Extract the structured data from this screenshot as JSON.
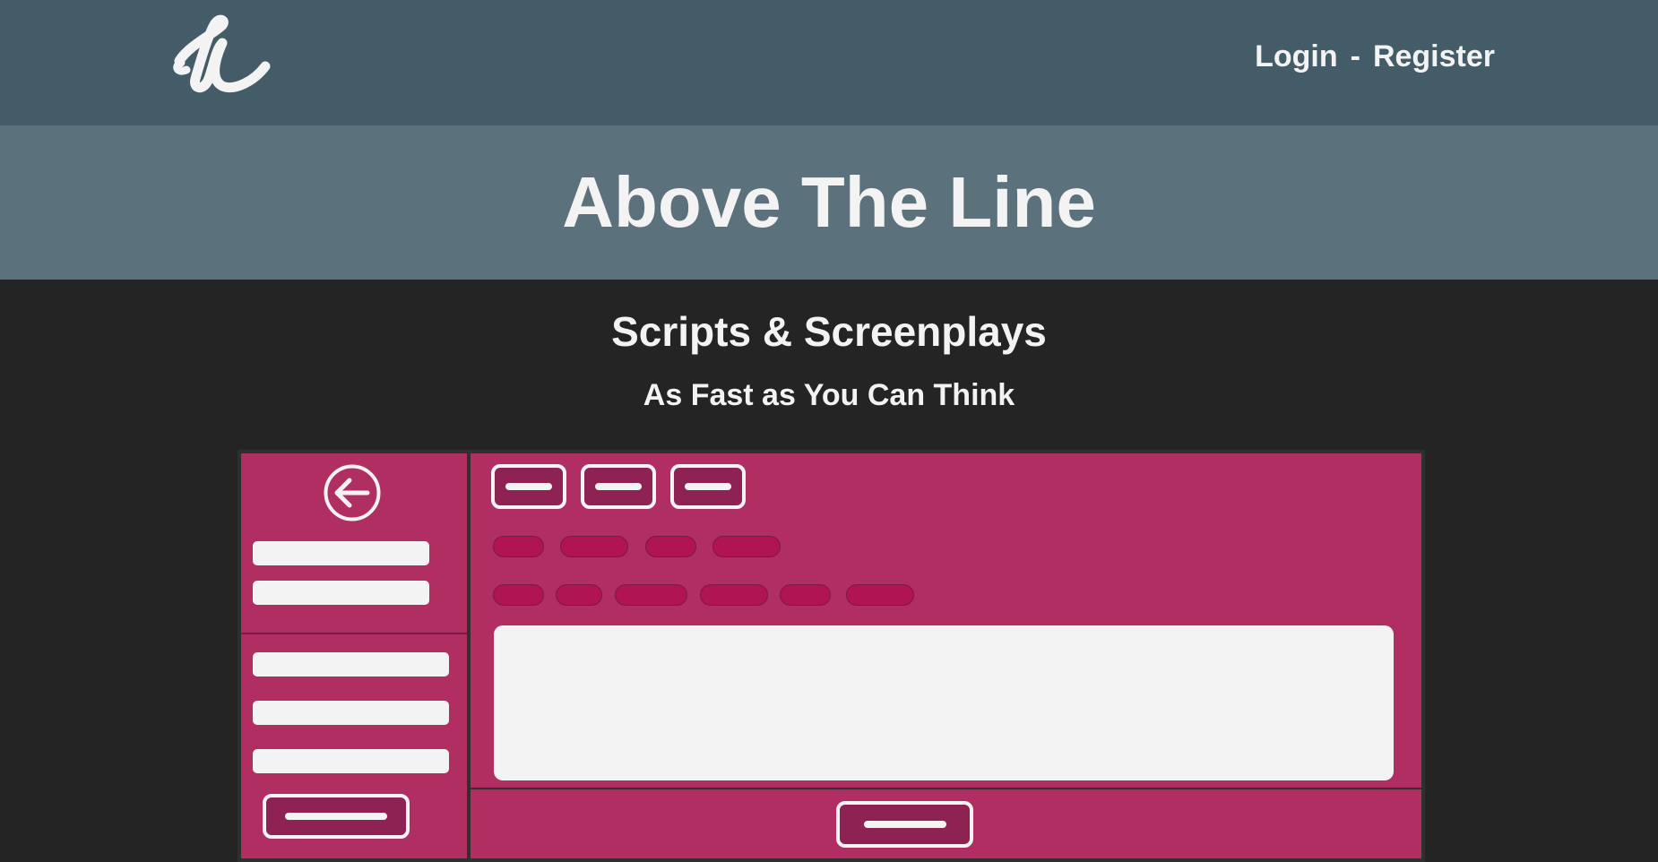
{
  "navbar": {
    "logo_icon": "signature-logo-icon",
    "login_label": "Login",
    "separator": "-",
    "register_label": "Register"
  },
  "hero": {
    "title": "Above The Line"
  },
  "intro": {
    "subtitle": "Scripts & Screenplays",
    "tagline": "As Fast as You Can Think"
  },
  "colors": {
    "navbar_bg": "#435c67",
    "hero_bg": "#5b717b",
    "page_bg": "#242424",
    "mockup_accent": "#b02e62",
    "text": "#f3f3f3"
  }
}
